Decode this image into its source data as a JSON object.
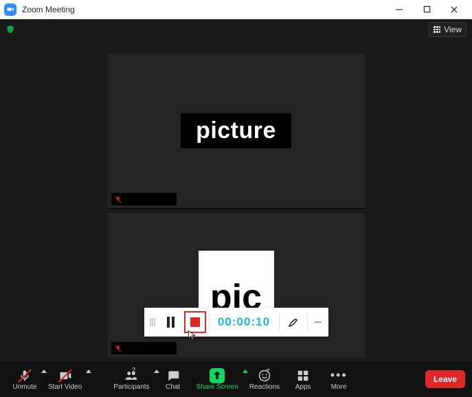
{
  "window": {
    "title": "Zoom Meeting"
  },
  "topbar": {
    "view_label": "View"
  },
  "tiles": {
    "top_label": "picture",
    "bottom_thumb_text": "pic"
  },
  "recording": {
    "timer": "00:00:10"
  },
  "controls": {
    "unmute": "Unmute",
    "start_video": "Start Video",
    "participants": "Participants",
    "participants_count": "2",
    "chat": "Chat",
    "share_screen": "Share Screen",
    "reactions": "Reactions",
    "apps": "Apps",
    "more": "More",
    "leave": "Leave"
  }
}
